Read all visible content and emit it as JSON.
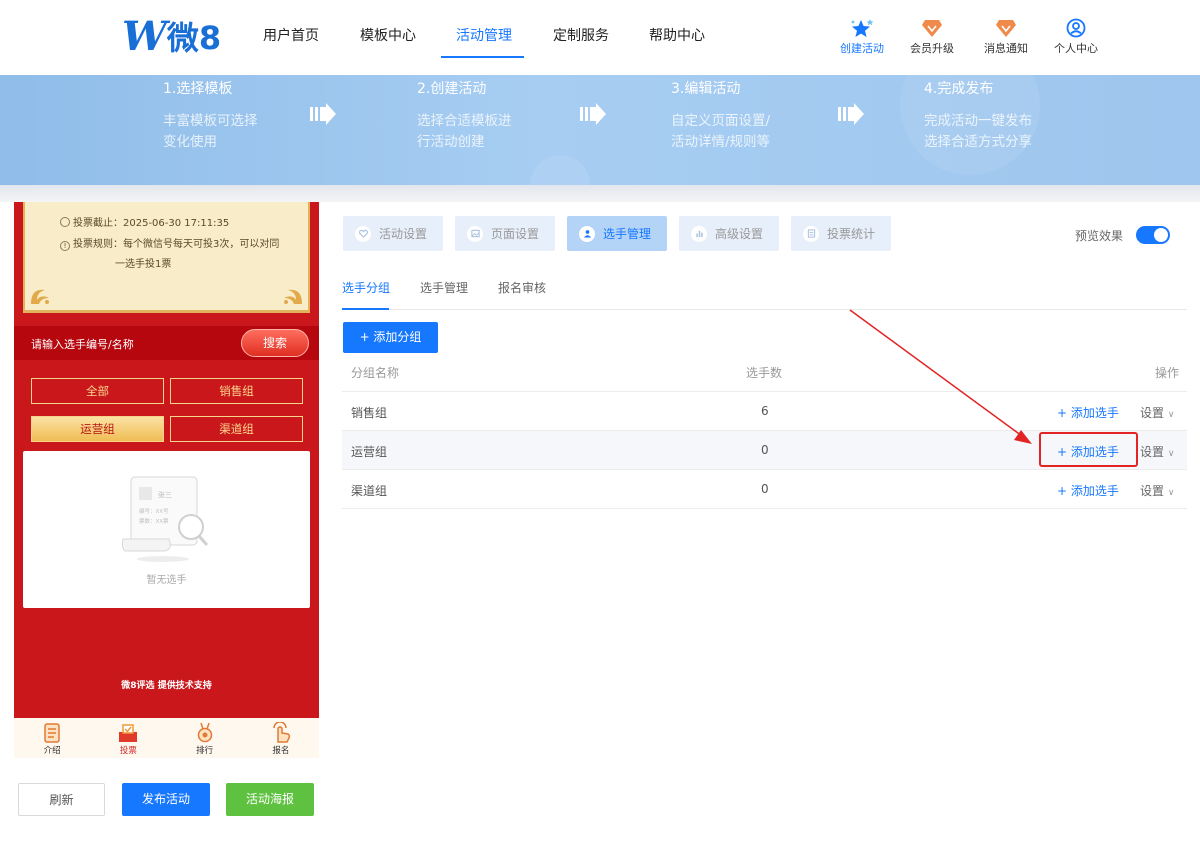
{
  "header": {
    "logo": {
      "w": "W",
      "text": "微8"
    },
    "nav": [
      "用户首页",
      "模板中心",
      "活动管理",
      "定制服务",
      "帮助中心"
    ],
    "active_nav": "活动管理",
    "icons": [
      {
        "label": "创建活动",
        "icon": "star-create-icon"
      },
      {
        "label": "会员升级",
        "icon": "vip-diamond-icon"
      },
      {
        "label": "消息通知",
        "icon": "message-diamond-icon"
      },
      {
        "label": "个人中心",
        "icon": "user-circle-icon"
      }
    ]
  },
  "banner": {
    "steps": [
      {
        "title": "1.选择模板",
        "desc1": "丰富模板可选择",
        "desc2": "变化使用"
      },
      {
        "title": "2.创建活动",
        "desc1": "选择合适模板进",
        "desc2": "行活动创建"
      },
      {
        "title": "3.编辑活动",
        "desc1": "自定义页面设置/",
        "desc2": "活动详情/规则等"
      },
      {
        "title": "4.完成发布",
        "desc1": "完成活动一键发布",
        "desc2": "选择合适方式分享"
      }
    ]
  },
  "phone": {
    "deadline": "投票截止：2025-06-30 17:11:35",
    "rule_line1": "投票规则：每个微信号每天可投3次，可以对同",
    "rule_line2": "一选手投1票",
    "search_placeholder": "请输入选手编号/名称",
    "search_button": "搜索",
    "groups": [
      "全部",
      "销售组",
      "运营组",
      "渠道组"
    ],
    "selected_group": "运营组",
    "empty_card": {
      "name": "张三",
      "no": "编号：XX号",
      "votes": "票数：XX票"
    },
    "empty_text": "暂无选手",
    "powered_by": "微8评选 提供技术支持",
    "tabs": [
      {
        "label": "介绍",
        "icon": "intro-doc-icon"
      },
      {
        "label": "投票",
        "icon": "vote-box-icon"
      },
      {
        "label": "排行",
        "icon": "medal-icon"
      },
      {
        "label": "报名",
        "icon": "hand-click-icon"
      }
    ]
  },
  "buttons": {
    "refresh": "刷新",
    "publish": "发布活动",
    "poster": "活动海报"
  },
  "panel": {
    "tabs": [
      {
        "label": "活动设置",
        "icon": "heart-icon"
      },
      {
        "label": "页面设置",
        "icon": "image-icon"
      },
      {
        "label": "选手管理",
        "icon": "person-icon"
      },
      {
        "label": "高级设置",
        "icon": "chart-icon"
      },
      {
        "label": "投票统计",
        "icon": "list-icon"
      }
    ],
    "active_tab": "选手管理",
    "preview_label": "预览效果",
    "preview_on": true,
    "subtabs": [
      "选手分组",
      "选手管理",
      "报名审核"
    ],
    "active_subtab": "选手分组",
    "add_group": "+ 添加分组",
    "table": {
      "headers": [
        "分组名称",
        "选手数",
        "操作"
      ],
      "rows": [
        {
          "name": "销售组",
          "count": "6",
          "add": "+ 添加选手",
          "set": "设置"
        },
        {
          "name": "运营组",
          "count": "0",
          "add": "+ 添加选手",
          "set": "设置"
        },
        {
          "name": "渠道组",
          "count": "0",
          "add": "+ 添加选手",
          "set": "设置"
        }
      ],
      "highlighted_row": 1
    }
  },
  "colors": {
    "primary": "#1677ff",
    "phone_red": "#c9171c",
    "green": "#5ec13f",
    "annotation_red": "#e32424"
  }
}
